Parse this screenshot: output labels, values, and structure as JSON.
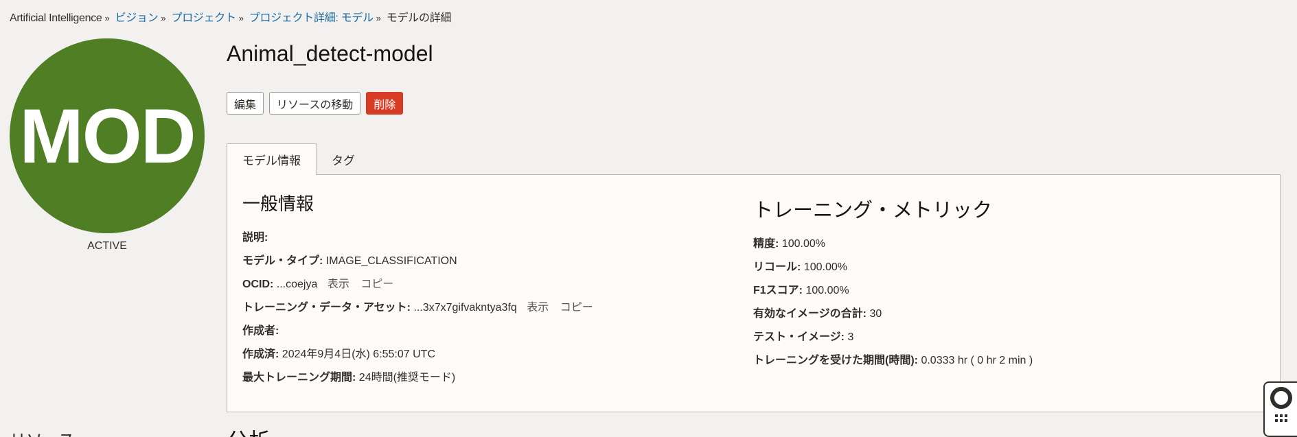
{
  "breadcrumb": {
    "root": "Artificial Intelligence",
    "items": [
      "ビジョン",
      "プロジェクト",
      "プロジェクト詳細: モデル"
    ],
    "current": "モデルの詳細",
    "separator": "»"
  },
  "avatar": {
    "text": "MOD",
    "color": "#4f7e24"
  },
  "status": "ACTIVE",
  "side_heading": "リソース",
  "title": "Animal_detect-model",
  "actions": {
    "edit": "編集",
    "move": "リソースの移動",
    "delete": "削除"
  },
  "tabs": {
    "model_info": "モデル情報",
    "tags": "タグ"
  },
  "general": {
    "heading": "一般情報",
    "description_label": "説明:",
    "description_value": "",
    "type_label": "モデル・タイプ:",
    "type_value": "IMAGE_CLASSIFICATION",
    "ocid_label": "OCID:",
    "ocid_value": "...coejya",
    "show": "表示",
    "copy": "コピー",
    "asset_label": "トレーニング・データ・アセット:",
    "asset_value": "...3x7x7gifvakntya3fq",
    "creator_label": "作成者:",
    "creator_value": "",
    "created_label": "作成済:",
    "created_value": "2024年9月4日(水) 6:55:07 UTC",
    "max_training_label": "最大トレーニング期間:",
    "max_training_value": "24時間(推奨モード)"
  },
  "metrics": {
    "heading": "トレーニング・メトリック",
    "precision_label": "精度:",
    "precision_value": "100.00%",
    "recall_label": "リコール:",
    "recall_value": "100.00%",
    "f1_label": "F1スコア:",
    "f1_value": "100.00%",
    "valid_images_label": "有効なイメージの合計:",
    "valid_images_value": "30",
    "test_images_label": "テスト・イメージ:",
    "test_images_value": "3",
    "duration_label": "トレーニングを受けた期間(時間):",
    "duration_value": "0.0333 hr ( 0 hr 2 min )"
  },
  "bottom_heading": "分析",
  "icons": {
    "help": "lifebuoy-icon",
    "grip": "grip-icon"
  }
}
